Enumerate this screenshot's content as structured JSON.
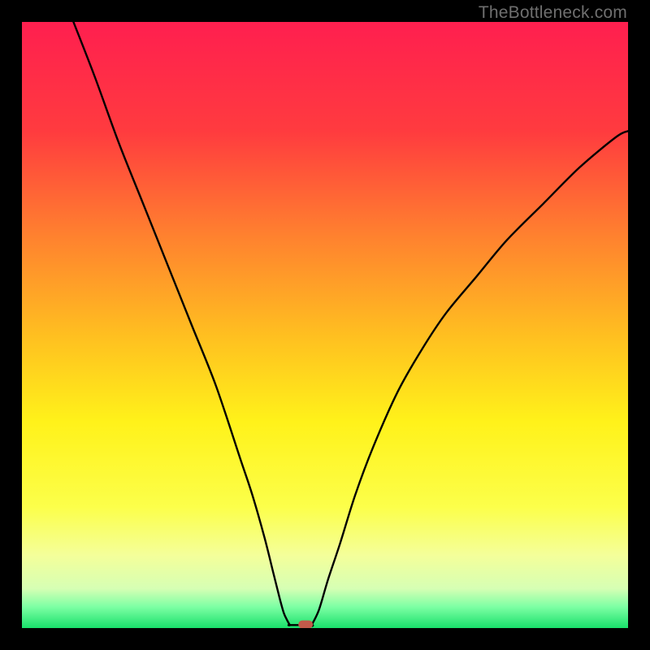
{
  "watermark": "TheBottleneck.com",
  "chart_data": {
    "type": "line",
    "title": "",
    "xlabel": "",
    "ylabel": "",
    "xlim": [
      0,
      100
    ],
    "ylim": [
      0,
      100
    ],
    "grid": false,
    "legend": false,
    "background_gradient": {
      "type": "vertical",
      "stops": [
        {
          "offset": 0.0,
          "color": "#ff1f4f"
        },
        {
          "offset": 0.18,
          "color": "#ff3b3f"
        },
        {
          "offset": 0.35,
          "color": "#ff802f"
        },
        {
          "offset": 0.52,
          "color": "#ffc020"
        },
        {
          "offset": 0.66,
          "color": "#fff21a"
        },
        {
          "offset": 0.8,
          "color": "#fcff4a"
        },
        {
          "offset": 0.88,
          "color": "#f4ff9a"
        },
        {
          "offset": 0.935,
          "color": "#d6ffb4"
        },
        {
          "offset": 0.965,
          "color": "#7dffa4"
        },
        {
          "offset": 1.0,
          "color": "#19e06b"
        }
      ]
    },
    "series": [
      {
        "name": "curve-left",
        "color": "#000000",
        "x": [
          8.5,
          12,
          16,
          20,
          24,
          28,
          32,
          36,
          38,
          40,
          41.5,
          42.5,
          43.2,
          43.8,
          44.2
        ],
        "y": [
          100,
          91,
          80,
          70,
          60,
          50,
          40,
          28,
          22,
          15,
          9,
          5,
          2.5,
          1.2,
          0.5
        ]
      },
      {
        "name": "flat-min",
        "color": "#000000",
        "x": [
          44.2,
          47.8
        ],
        "y": [
          0.5,
          0.5
        ]
      },
      {
        "name": "curve-right",
        "color": "#000000",
        "x": [
          47.8,
          49,
          50.5,
          52.5,
          55,
          58,
          62,
          66,
          70,
          75,
          80,
          86,
          92,
          98,
          100
        ],
        "y": [
          0.5,
          3,
          8,
          14,
          22,
          30,
          39,
          46,
          52,
          58,
          64,
          70,
          76,
          81,
          82
        ]
      }
    ],
    "marker": {
      "name": "min-point-marker",
      "shape": "rounded-rect",
      "cx": 46.8,
      "cy": 0.6,
      "w": 2.4,
      "h": 1.3,
      "color": "#c25a4a"
    }
  }
}
